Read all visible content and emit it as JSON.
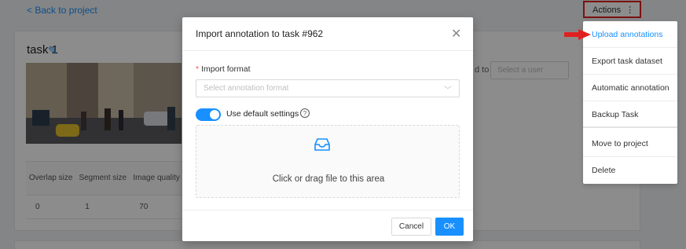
{
  "page": {
    "back_link": "< Back to project",
    "task_title": "task 1",
    "assignee_label": "d to",
    "assignee_placeholder": "Select a user",
    "table": {
      "headers": [
        "Overlap size",
        "Segment size",
        "Image quality"
      ],
      "values": [
        "0",
        "1",
        "70"
      ]
    }
  },
  "actions": {
    "label": "Actions",
    "menu": [
      "Upload annotations",
      "Export task dataset",
      "Automatic annotation",
      "Backup Task",
      "Move to project",
      "Delete"
    ]
  },
  "modal": {
    "title": "Import annotation to task #962",
    "format_label": "Import format",
    "format_placeholder": "Select annotation format",
    "default_settings_label": "Use default settings",
    "default_settings_on": true,
    "dropzone_text": "Click or drag file to this area",
    "cancel_label": "Cancel",
    "ok_label": "OK"
  },
  "colors": {
    "accent": "#1890ff",
    "highlight": "#e02020"
  }
}
